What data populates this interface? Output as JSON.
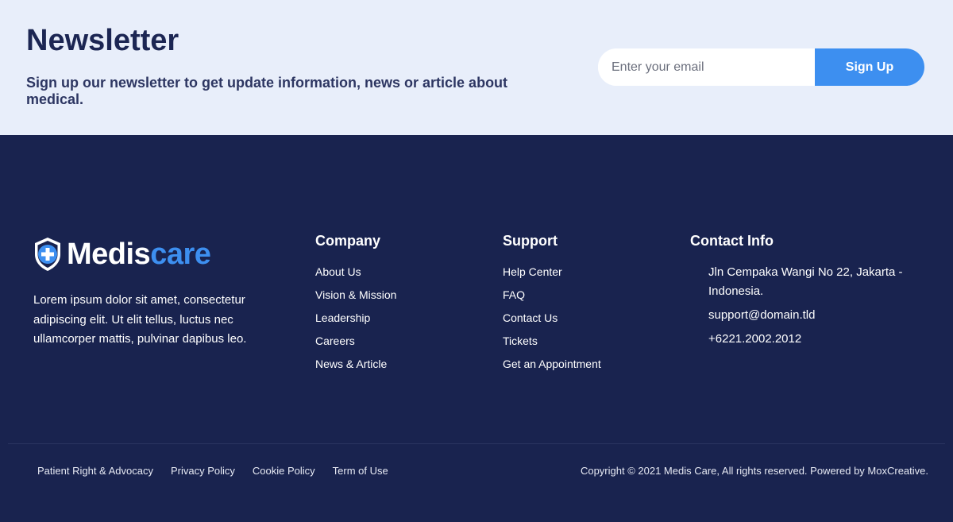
{
  "newsletter": {
    "title": "Newsletter",
    "description": "Sign up our newsletter to get update information, news or article about medical.",
    "email_placeholder": "Enter your email",
    "button_label": "Sign Up"
  },
  "brand": {
    "name_part1": "Medis",
    "name_part2": "care",
    "logo_icon": "shield-plus-icon",
    "about": "Lorem ipsum dolor sit amet, consectetur adipiscing elit. Ut elit tellus, luctus nec ullamcorper mattis, pulvinar dapibus leo."
  },
  "company": {
    "heading": "Company",
    "links": [
      "About Us",
      "Vision & Mission",
      "Leadership",
      "Careers",
      "News & Article"
    ]
  },
  "support": {
    "heading": "Support",
    "links": [
      "Help Center",
      "FAQ",
      "Contact Us",
      "Tickets",
      "Get an Appointment"
    ]
  },
  "contact": {
    "heading": "Contact Info",
    "address": "Jln Cempaka Wangi No 22, Jakarta - Indonesia.",
    "email": "support@domain.tld",
    "phone": "+6221.2002.2012"
  },
  "bottom": {
    "links": [
      "Patient Right & Advocacy",
      "Privacy Policy",
      "Cookie Policy",
      "Term of Use"
    ],
    "copyright": "Copyright © 2021 Medis Care, All rights reserved. Powered by MoxCreative."
  },
  "colors": {
    "newsletter_bg": "#e8eefa",
    "footer_bg": "#19234f",
    "accent": "#3d8ff0",
    "heading_dark": "#1c2653"
  }
}
